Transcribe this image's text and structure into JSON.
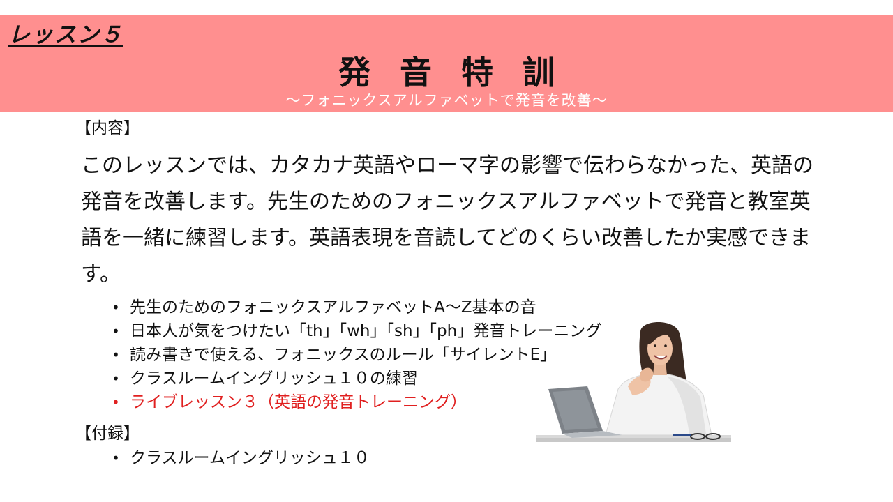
{
  "header": {
    "lesson_label": "レッスン５",
    "title": "発音特訓",
    "subtitle": "～フォニックスアルファベットで発音を改善～"
  },
  "content": {
    "heading": "【内容】",
    "description": "このレッスンでは、カタカナ英語やローマ字の影響で伝わらなかった、英語の発音を改善します。先生のためのフォニックスアルファベットで発音と教室英語を一緒に練習します。英語表現を音読してどのくらい改善したか実感できます。",
    "items": [
      {
        "label": "先生のためのフォニックスアルファベットA～Z基本の音"
      },
      {
        "label": "日本人が気をつけたい「th」「wh」「sh」「ph」発音トレーニング"
      },
      {
        "label": "読み書きで使える、フォニックスのルール「サイレントE」"
      },
      {
        "label": "クラスルームイングリッシュ１０の練習"
      },
      {
        "label": "ライブレッスン３（英語の発音トレーニング）"
      }
    ]
  },
  "appendix": {
    "heading": "【付録】",
    "items": [
      {
        "label": "クラスルームイングリッシュ１０"
      }
    ]
  },
  "colors": {
    "header_band": "#ff8f8f",
    "subtitle_text": "#ffffff",
    "highlight_item": "#e02020"
  },
  "illustration": {
    "icon": "woman-with-laptop-photo"
  }
}
